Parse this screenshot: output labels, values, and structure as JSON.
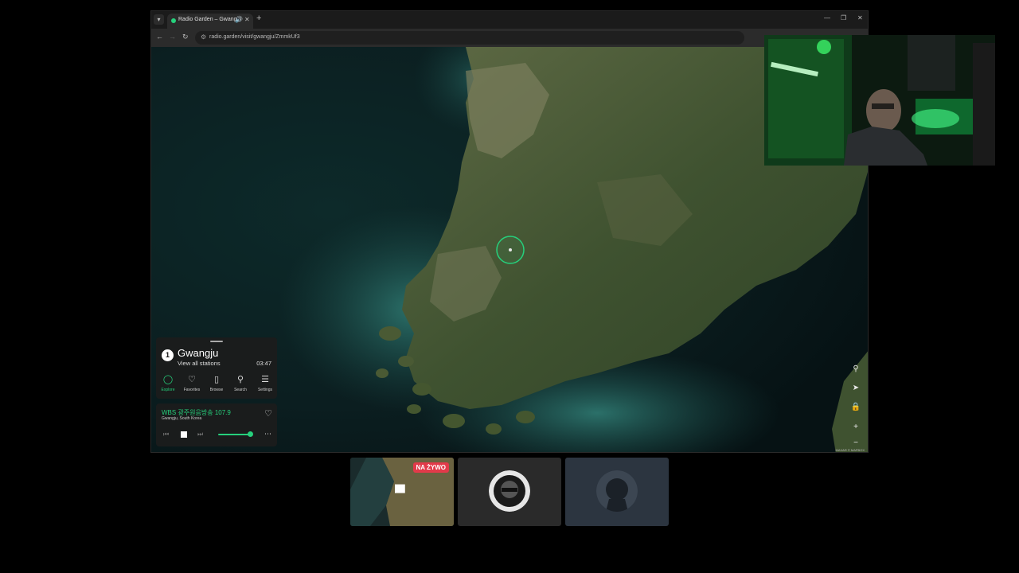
{
  "browser": {
    "tab_title": "Radio Garden – Gwangju",
    "url": "radio.garden/visit/gwangju/ZmmkUf3"
  },
  "panel": {
    "place_name": "Gwangju",
    "place_count": "1",
    "view_all": "View all stations",
    "time": "03:47",
    "nav": [
      {
        "label": "Explore",
        "icon": "explore-icon"
      },
      {
        "label": "Favorites",
        "icon": "heart-icon"
      },
      {
        "label": "Browse",
        "icon": "map-icon"
      },
      {
        "label": "Search",
        "icon": "search-icon"
      },
      {
        "label": "Settings",
        "icon": "menu-icon"
      }
    ],
    "station_name": "WBS 광주원음방송 107.9",
    "station_location": "Gwangju, South Korea",
    "volume_fraction": 0.85
  },
  "map": {
    "attribution": "MAXAR © MAPBOX"
  },
  "tiles": {
    "live_label": "NA ŻYWO"
  },
  "colors": {
    "accent": "#26d07c",
    "live": "#e23a4a"
  }
}
